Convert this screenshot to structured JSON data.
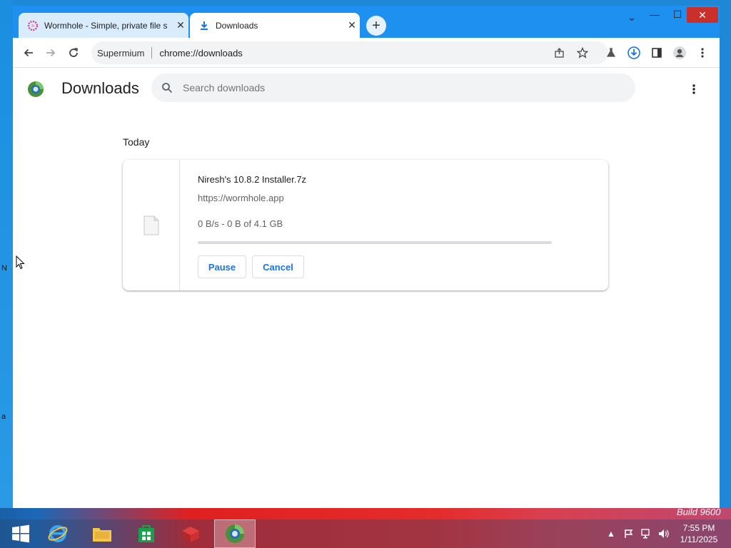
{
  "browser": {
    "tabs": [
      {
        "title": "Wormhole - Simple, private file s",
        "active": false
      },
      {
        "title": "Downloads",
        "active": true
      }
    ],
    "new_tab_symbol": "+",
    "window_controls": {
      "chevron": "⌄",
      "minimize": "—",
      "maximize": "☐",
      "close": "✕"
    },
    "omnibox": {
      "site": "Supermium",
      "url": "chrome://downloads"
    },
    "toolbar_icons": [
      "back-icon",
      "forward-icon",
      "reload-icon",
      "share-icon",
      "bookmark-star-icon",
      "labs-flask-icon",
      "download-indicator-icon",
      "side-panel-icon",
      "profile-icon",
      "menu-kebab-icon"
    ]
  },
  "downloads_page": {
    "title": "Downloads",
    "search": {
      "placeholder": "Search downloads"
    },
    "section_label": "Today",
    "items": [
      {
        "file_name": "Niresh's 10.8.2 Installer.7z",
        "source_url": "https://wormhole.app",
        "status": "0 B/s - 0 B of 4.1 GB",
        "progress": 0,
        "pause_label": "Pause",
        "cancel_label": "Cancel"
      }
    ]
  },
  "desktop": {
    "left_edge_fragments": [
      "N",
      "a"
    ],
    "wallpaper_text": "Build 9600"
  },
  "taskbar": {
    "items": [
      "start-icon",
      "internet-explorer-icon",
      "file-explorer-icon",
      "store-icon",
      "app-red-box-icon",
      "supermium-icon"
    ],
    "active_item": "supermium-icon",
    "tray_icons": [
      "show-hidden-icons-icon",
      "action-center-flag-icon",
      "network-icon",
      "volume-icon"
    ],
    "clock": {
      "time": "7:55 PM",
      "date": "1/11/2025"
    }
  },
  "colors": {
    "accent": "#1a73e8",
    "titlebar": "#1e90ef",
    "close_button": "#c9302c"
  }
}
